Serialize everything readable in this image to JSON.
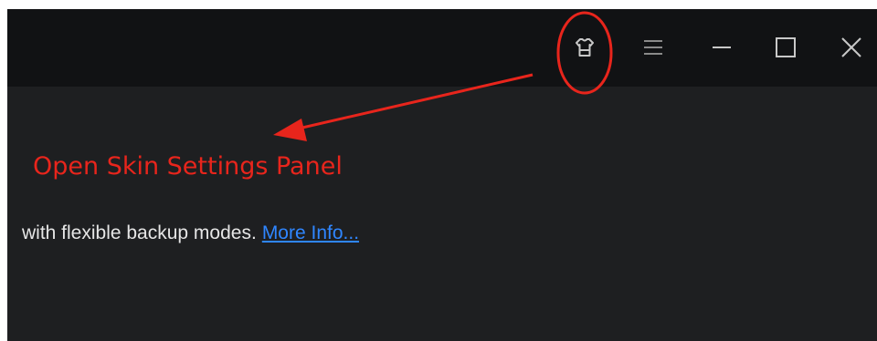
{
  "titlebar": {
    "buttons": {
      "skin": {
        "icon": "shirt-icon"
      },
      "menu": {
        "icon": "hamburger-menu-icon"
      },
      "minimize": {
        "icon": "minimize-icon"
      },
      "maximize": {
        "icon": "maximize-icon"
      },
      "close": {
        "icon": "close-icon"
      }
    }
  },
  "annotation": {
    "label": "Open Skin Settings Panel",
    "color": "#e8251c"
  },
  "content": {
    "description": "with flexible backup modes.",
    "link_text": "More Info...",
    "link_color": "#2f86ff",
    "text_color": "#e6e6e6"
  },
  "colors": {
    "titlebar_bg": "#111214",
    "window_bg": "#1e1f21",
    "icon_color": "#c8c8c8"
  }
}
